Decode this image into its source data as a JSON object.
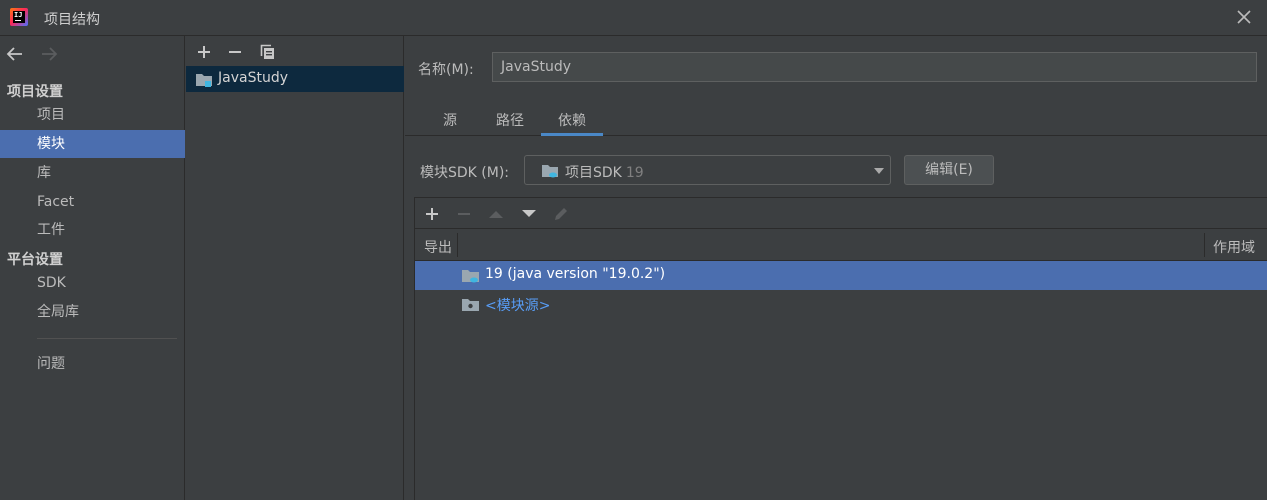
{
  "window": {
    "title": "项目结构",
    "app_icon_text": "IJ"
  },
  "nav": {
    "project_settings_heading": "项目设置",
    "items_project": [
      "项目",
      "模块",
      "库",
      "Facet",
      "工件"
    ],
    "platform_settings_heading": "平台设置",
    "items_platform": [
      "SDK",
      "全局库"
    ],
    "problems": "问题",
    "selected": "模块"
  },
  "modules": {
    "items": [
      "JavaStudy"
    ]
  },
  "detail": {
    "name_label": "名称(M):",
    "name_value": "JavaStudy",
    "tabs": [
      "源",
      "路径",
      "依赖"
    ],
    "active_tab": "依赖",
    "sdk_label": "模块SDK (M):",
    "sdk_value": "项目SDK",
    "sdk_version": "19",
    "edit_button": "编辑(E)"
  },
  "dependencies": {
    "columns": {
      "export": "导出",
      "scope": "作用域"
    },
    "rows": [
      {
        "label": "19 (java version \"19.0.2\")",
        "selected": true
      },
      {
        "label": "<模块源>",
        "selected": false
      }
    ]
  },
  "colors": {
    "background": "#3c3f41",
    "selection": "#4b6eaf",
    "tree_selection": "#0d293e",
    "link": "#589df6",
    "tab_underline": "#4a88c7"
  }
}
